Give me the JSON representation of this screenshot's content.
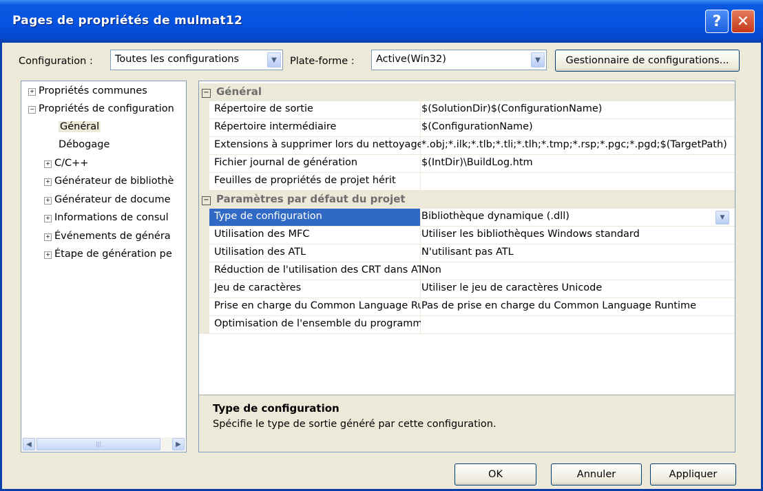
{
  "window": {
    "title": "Pages de propriétés de mulmat12",
    "help": "?",
    "close": "✕"
  },
  "toolbar": {
    "configuration_label": "Configuration :",
    "configuration_value": "Toutes les configurations",
    "platform_label": "Plate-forme :",
    "platform_value": "Active(Win32)",
    "config_manager_button": "Gestionnaire de configurations..."
  },
  "tree": [
    {
      "label": "Propriétés communes",
      "expander": "+"
    },
    {
      "label": "Propriétés de configuration",
      "expander": "−"
    },
    {
      "label": "Général",
      "expander": ""
    },
    {
      "label": "Débogage",
      "expander": ""
    },
    {
      "label": "C/C++",
      "expander": "+"
    },
    {
      "label": "Générateur de bibliothè",
      "expander": "+"
    },
    {
      "label": "Générateur de docume",
      "expander": "+"
    },
    {
      "label": "Informations de consul",
      "expander": "+"
    },
    {
      "label": "Événements de généra",
      "expander": "+"
    },
    {
      "label": "Étape de génération pe",
      "expander": "+"
    }
  ],
  "grid": {
    "categories": [
      {
        "label": "Général",
        "toggle": "⊟"
      },
      {
        "label": "Paramètres par défaut du projet",
        "toggle": "⊟"
      }
    ],
    "general_rows": [
      {
        "name": "Répertoire de sortie",
        "value": "$(SolutionDir)$(ConfigurationName)"
      },
      {
        "name": "Répertoire intermédiaire",
        "value": "$(ConfigurationName)"
      },
      {
        "name": "Extensions à supprimer lors du nettoyage",
        "value": "*.obj;*.ilk;*.tlb;*.tli;*.tlh;*.tmp;*.rsp;*.pgc;*.pgd;$(TargetPath)"
      },
      {
        "name": "Fichier journal de génération",
        "value": "$(IntDir)\\BuildLog.htm"
      },
      {
        "name": "Feuilles de propriétés de projet hérit",
        "value": ""
      }
    ],
    "defaults_rows": [
      {
        "name": "Type de configuration",
        "value": "Bibliothèque dynamique (.dll)"
      },
      {
        "name": "Utilisation des MFC",
        "value": "Utiliser les bibliothèques Windows standard"
      },
      {
        "name": "Utilisation des ATL",
        "value": "N'utilisant pas ATL"
      },
      {
        "name": "Réduction de l'utilisation des CRT dans ATL",
        "value": "Non"
      },
      {
        "name": "Jeu de caractères",
        "value": "Utiliser le jeu de caractères Unicode"
      },
      {
        "name": "Prise en charge du Common Language Runtime",
        "value": "Pas de prise en charge du Common Language Runtime"
      },
      {
        "name": "Optimisation de l'ensemble du programme",
        "value": ""
      }
    ],
    "description": {
      "title": "Type de configuration",
      "text": "Spécifie le type de sortie généré par cette configuration."
    }
  },
  "buttons": {
    "ok": "OK",
    "cancel": "Annuler",
    "apply": "Appliquer"
  },
  "colors": {
    "title_bar": "#0554e3",
    "selection": "#316ac5",
    "dialog_bg": "#ece9d8"
  }
}
